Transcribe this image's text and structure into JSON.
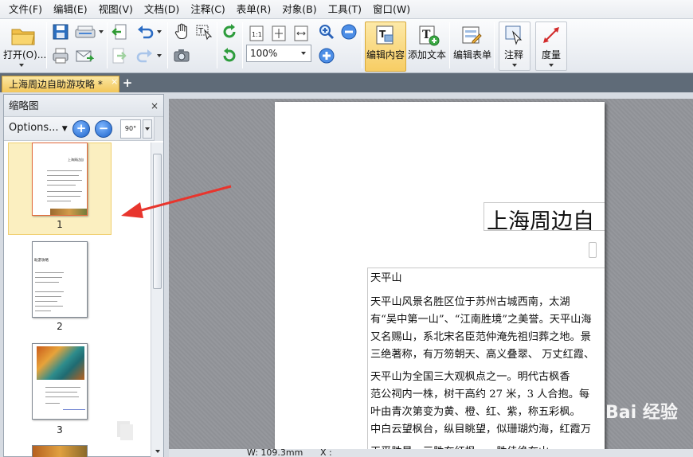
{
  "menu": [
    "文件(F)",
    "编辑(E)",
    "视图(V)",
    "文档(D)",
    "注释(C)",
    "表单(R)",
    "对象(B)",
    "工具(T)",
    "窗口(W)"
  ],
  "toolbar": {
    "open_label": "打开(O)...",
    "zoom_value": "100%",
    "edit_content_label": "编辑内容",
    "add_text_label": "添加文本",
    "edit_form_label": "编辑表单",
    "annotate_label": "注释",
    "measure_label": "度量",
    "actual_size_label": "1:1"
  },
  "tab": {
    "title": "上海周边自助游攻略 *",
    "close": "×",
    "new": "+"
  },
  "sidebar": {
    "title": "缩略图",
    "close": "×",
    "options_label": "Options...",
    "rotate_label": "90°",
    "pages": [
      {
        "number": "1",
        "title": "上海周边自"
      },
      {
        "number": "2",
        "title": "助游攻略"
      },
      {
        "number": "3"
      }
    ]
  },
  "document": {
    "title": "上海周边自",
    "lines": [
      "天平山",
      "    天平山风景名胜区位于苏州古城西南，太湖",
      "有“吴中第一山”、“江南胜境”之美誉。天平山海",
      "又名赐山，系北宋名臣范仲淹先祖归葬之地。景",
      "三绝著称，有万笏朝天、高义叠翠、 万丈红霞、",
      "    天平山为全国三大观枫点之一。明代古枫香",
      "范公祠内一株，树干高约 27 米，3 人合抱。每",
      "叶由青次第变为黄、橙、红、紫，称五彩枫。",
      "中白云望枫台，纵目眺望，似珊瑚灼海，红霞万",
      "    天平胜景，三胜在红枫，一胜佳绝在山"
    ]
  },
  "status": {
    "width": "W: 109.3mm",
    "x": "X :"
  },
  "watermark": "Bai 经验",
  "colors": {
    "active_button": "#f7cd64",
    "arrow": "#e8352d",
    "tab_bar": "#5f6b78"
  }
}
